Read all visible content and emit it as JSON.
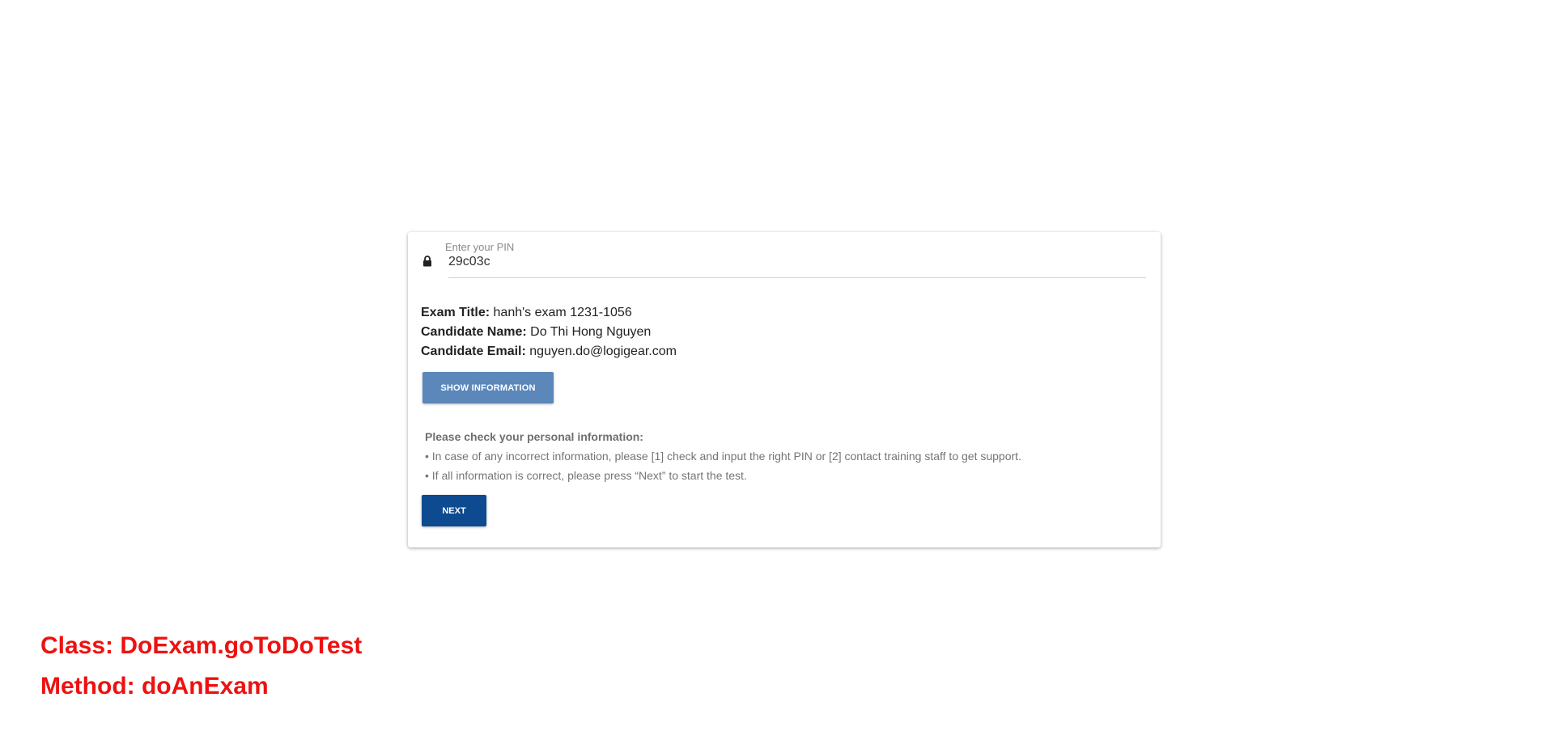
{
  "pin": {
    "label": "Enter your PIN",
    "value": "29c03c",
    "icon": "lock-icon"
  },
  "exam_info": {
    "title_label": "Exam Title:",
    "title_value": "hanh's exam 1231-1056",
    "name_label": "Candidate Name:",
    "name_value": "Do Thi Hong Nguyen",
    "email_label": "Candidate Email:",
    "email_value": "nguyen.do@logigear.com"
  },
  "buttons": {
    "show_info": "SHOW INFORMATION",
    "next": "NEXT"
  },
  "notice": {
    "title": "Please check your personal information:",
    "line1": "• In case of any incorrect information, please [1] check and input the right PIN or [2] contact training staff to get support.",
    "line2": "• If all information is correct, please press “Next” to start the test."
  },
  "annotation": {
    "class_line": "Class: DoExam.goToDoTest",
    "method_line": "Method: doAnExam"
  },
  "colors": {
    "show_button": "#5b87ba",
    "next_button": "#0d4a8f",
    "annotation": "#ee1111"
  }
}
